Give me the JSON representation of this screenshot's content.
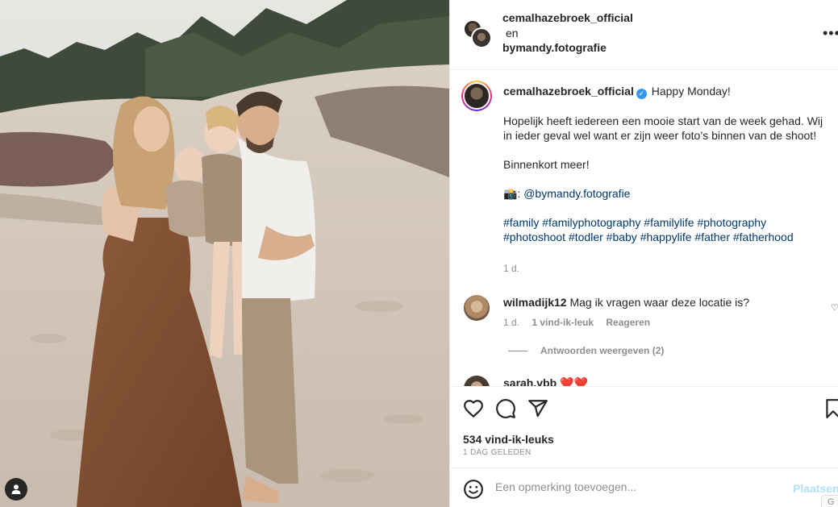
{
  "header": {
    "user1": "cemalhazebroek_official",
    "connector": "en",
    "user2": "bymandy.fotografie",
    "more_icon": "more-horizontal-icon"
  },
  "caption": {
    "username": "cemalhazebroek_official",
    "verified_icon": "verified-badge-icon",
    "first_line": "Happy Monday!",
    "para1": "Hopelijk heeft iedereen een mooie start van de week gehad. Wij in ieder geval wel want er zijn weer foto’s binnen van de shoot!",
    "para2": "Binnenkort meer!",
    "camera_emoji": "📸",
    "credit_sep": ":",
    "credit_link": "@bymandy.fotografie",
    "hashtags_line1": "#family #familyphotography #familylife #photography",
    "hashtags_line2": "#photoshoot #todler #baby #happylife #father #fatherhood",
    "time": "1 d."
  },
  "comments": [
    {
      "username": "wilmadijk12",
      "text": "Mag ik vragen waar deze locatie is?",
      "time": "1 d.",
      "likes": "1 vind-ik-leuk",
      "reply": "Reageren",
      "view_replies": "Antwoorden weergeven (2)"
    },
    {
      "username": "sarah.vbb",
      "hearts": "❤️❤️"
    }
  ],
  "actions": {
    "like_icon": "heart-icon",
    "comment_icon": "comment-icon",
    "share_icon": "paper-plane-icon",
    "save_icon": "bookmark-icon",
    "likes": "534 vind-ik-leuks",
    "posted": "1 DAG GELEDEN"
  },
  "add_comment": {
    "emoji_icon": "smiley-icon",
    "placeholder": "Een opmerking toevoegen...",
    "post_label": "Plaatsen",
    "badge": "G"
  },
  "photo": {
    "tag_icon": "user-tag-icon"
  },
  "colors": {
    "link": "#00376b",
    "secondary": "#8e8e8e",
    "verified": "#3897f0",
    "post_button": "#b2dffc"
  }
}
